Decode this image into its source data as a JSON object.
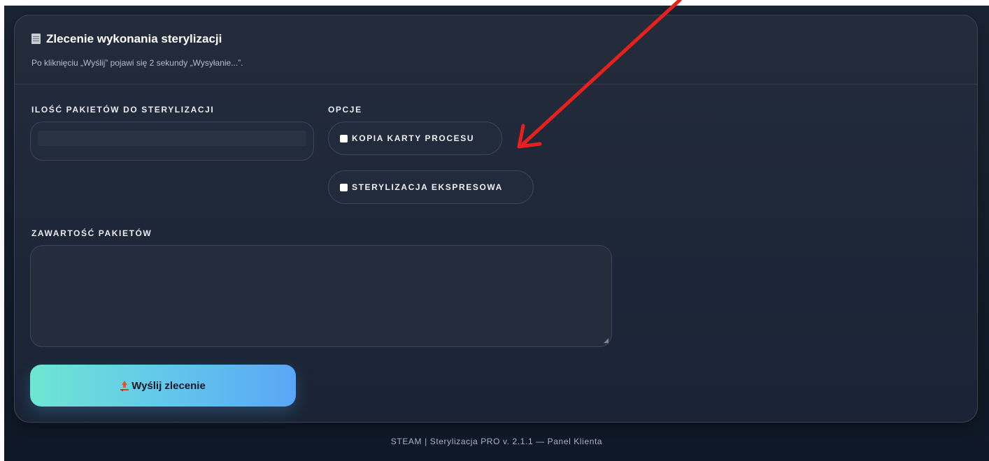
{
  "form": {
    "title": "Zlecenie wykonania sterylizacji",
    "subtitle": "Po kliknięciu „Wyślij” pojawi się 2 sekundy „Wysyłanie...”.",
    "qty_label": "ILOŚĆ PAKIETÓW DO STERYLIZACJI",
    "qty_value": "",
    "options_label": "OPCJE",
    "options": [
      {
        "label": "KOPIA KARTY PROCESU",
        "checked": false
      },
      {
        "label": "STERYLIZACJA EKSPRESOWA",
        "checked": false
      }
    ],
    "contents_label": "ZAWARTOŚĆ PAKIETÓW",
    "contents_value": "",
    "submit_label": "Wyślij zlecenie"
  },
  "footer": {
    "text": "STEAM | Sterylizacja PRO v. 2.1.1 — Panel Klienta"
  },
  "colors": {
    "annotation_arrow": "#e8201c",
    "submit_gradient_start": "#6ee6d4",
    "submit_gradient_end": "#5aa6f6"
  },
  "icons": {
    "title_icon": "document-icon",
    "submit_icon": "upload-icon"
  }
}
